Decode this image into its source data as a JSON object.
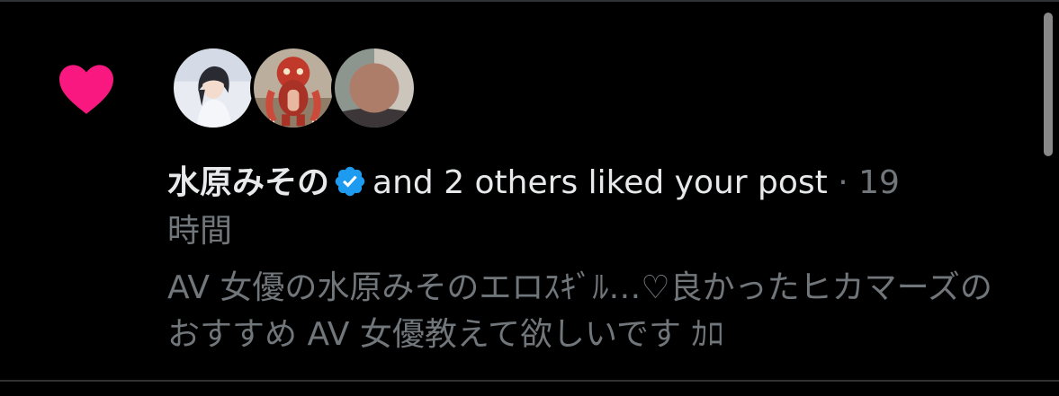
{
  "notification": {
    "icon": "heart-icon",
    "icon_color": "#f91880",
    "avatars": [
      {
        "name": "avatar-1"
      },
      {
        "name": "avatar-2"
      },
      {
        "name": "avatar-3"
      }
    ],
    "user_name": "水原みその",
    "verified_icon": "verified-badge-icon",
    "verified_color": "#1d9bf0",
    "action_text": "and 2 others liked your post",
    "separator": " · ",
    "time_part1": "19",
    "time_part2": "時間",
    "post_preview": "AV 女優の水原みそのエロｽｷﾞﾙ…♡良かったヒカマーズのおすすめ AV 女優教えて欲しいです ｶﾛ"
  },
  "colors": {
    "background": "#000000",
    "primary_text": "#e7e9ea",
    "secondary_text": "#71767b"
  }
}
